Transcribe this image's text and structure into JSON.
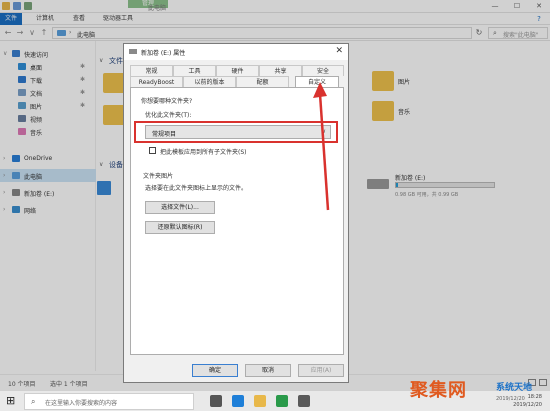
{
  "window": {
    "title": "此电脑",
    "manage_tab": "管理",
    "minimize": "—",
    "maximize": "☐",
    "close": "✕"
  },
  "ribbon": {
    "tabs": [
      "文件",
      "计算机",
      "查看",
      "驱动器工具"
    ],
    "help": "?"
  },
  "address": {
    "back": "←",
    "forward": "→",
    "up_recent": "∨",
    "up": "↑",
    "separator": "›",
    "path": "此电脑",
    "refresh": "↻",
    "search_icon": "⌕",
    "search_placeholder": "搜索\"此电脑\""
  },
  "nav": {
    "quick_access": "快速访问",
    "items": [
      {
        "label": "桌面",
        "pinned": true
      },
      {
        "label": "下载",
        "pinned": true
      },
      {
        "label": "文档",
        "pinned": true
      },
      {
        "label": "图片",
        "pinned": true
      },
      {
        "label": "视频",
        "pinned": false
      },
      {
        "label": "音乐",
        "pinned": false
      }
    ],
    "pin_glyph": "✱",
    "onedrive": "OneDrive",
    "this_pc": "此电脑",
    "new_volume": "新加卷 (E:)",
    "network": "网络"
  },
  "content": {
    "folders_header": "文件夹",
    "devices_header": "设备和",
    "folder_pictures": "图片",
    "folder_music": "音乐",
    "drive": {
      "name": "新加卷 (E:)",
      "size": "0.98 GB 可用，共 0.99 GB",
      "used_fraction": 0.01
    }
  },
  "status": {
    "items": "10 个项目",
    "selected": "选中 1 个项目"
  },
  "taskbar": {
    "start": "⊞",
    "search_icon": "⌕",
    "search_placeholder": "在这里输入你要搜索的内容",
    "time": "18:28",
    "date": "2019/12/20"
  },
  "dialog": {
    "title": "新加卷 (E:) 属性",
    "close": "✕",
    "tabs_row1": [
      "常规",
      "工具",
      "硬件",
      "共享",
      "安全"
    ],
    "tabs_row2": [
      "ReadyBoost",
      "以前的版本",
      "配额",
      "自定义"
    ],
    "question": "你想要哪种文件夹?",
    "optimize_label": "优化此文件夹(T):",
    "optimize_value": "常规项目",
    "dropdown_arrow": "∨",
    "apply_subfolders": "把此模板应用到所有子文件夹(S)",
    "folder_pictures_label": "文件夹图片",
    "folder_pictures_desc": "选择要在此文件夹图标上显示的文件。",
    "choose_file": "选择文件(L)...",
    "restore_default": "还原默认图标(R)",
    "ok": "确定",
    "cancel": "取消",
    "apply": "应用(A)",
    "annotation_color": "#d9322e"
  },
  "watermark": {
    "brand": "聚集网",
    "site": "系统天地",
    "date": "2019/12/20"
  }
}
